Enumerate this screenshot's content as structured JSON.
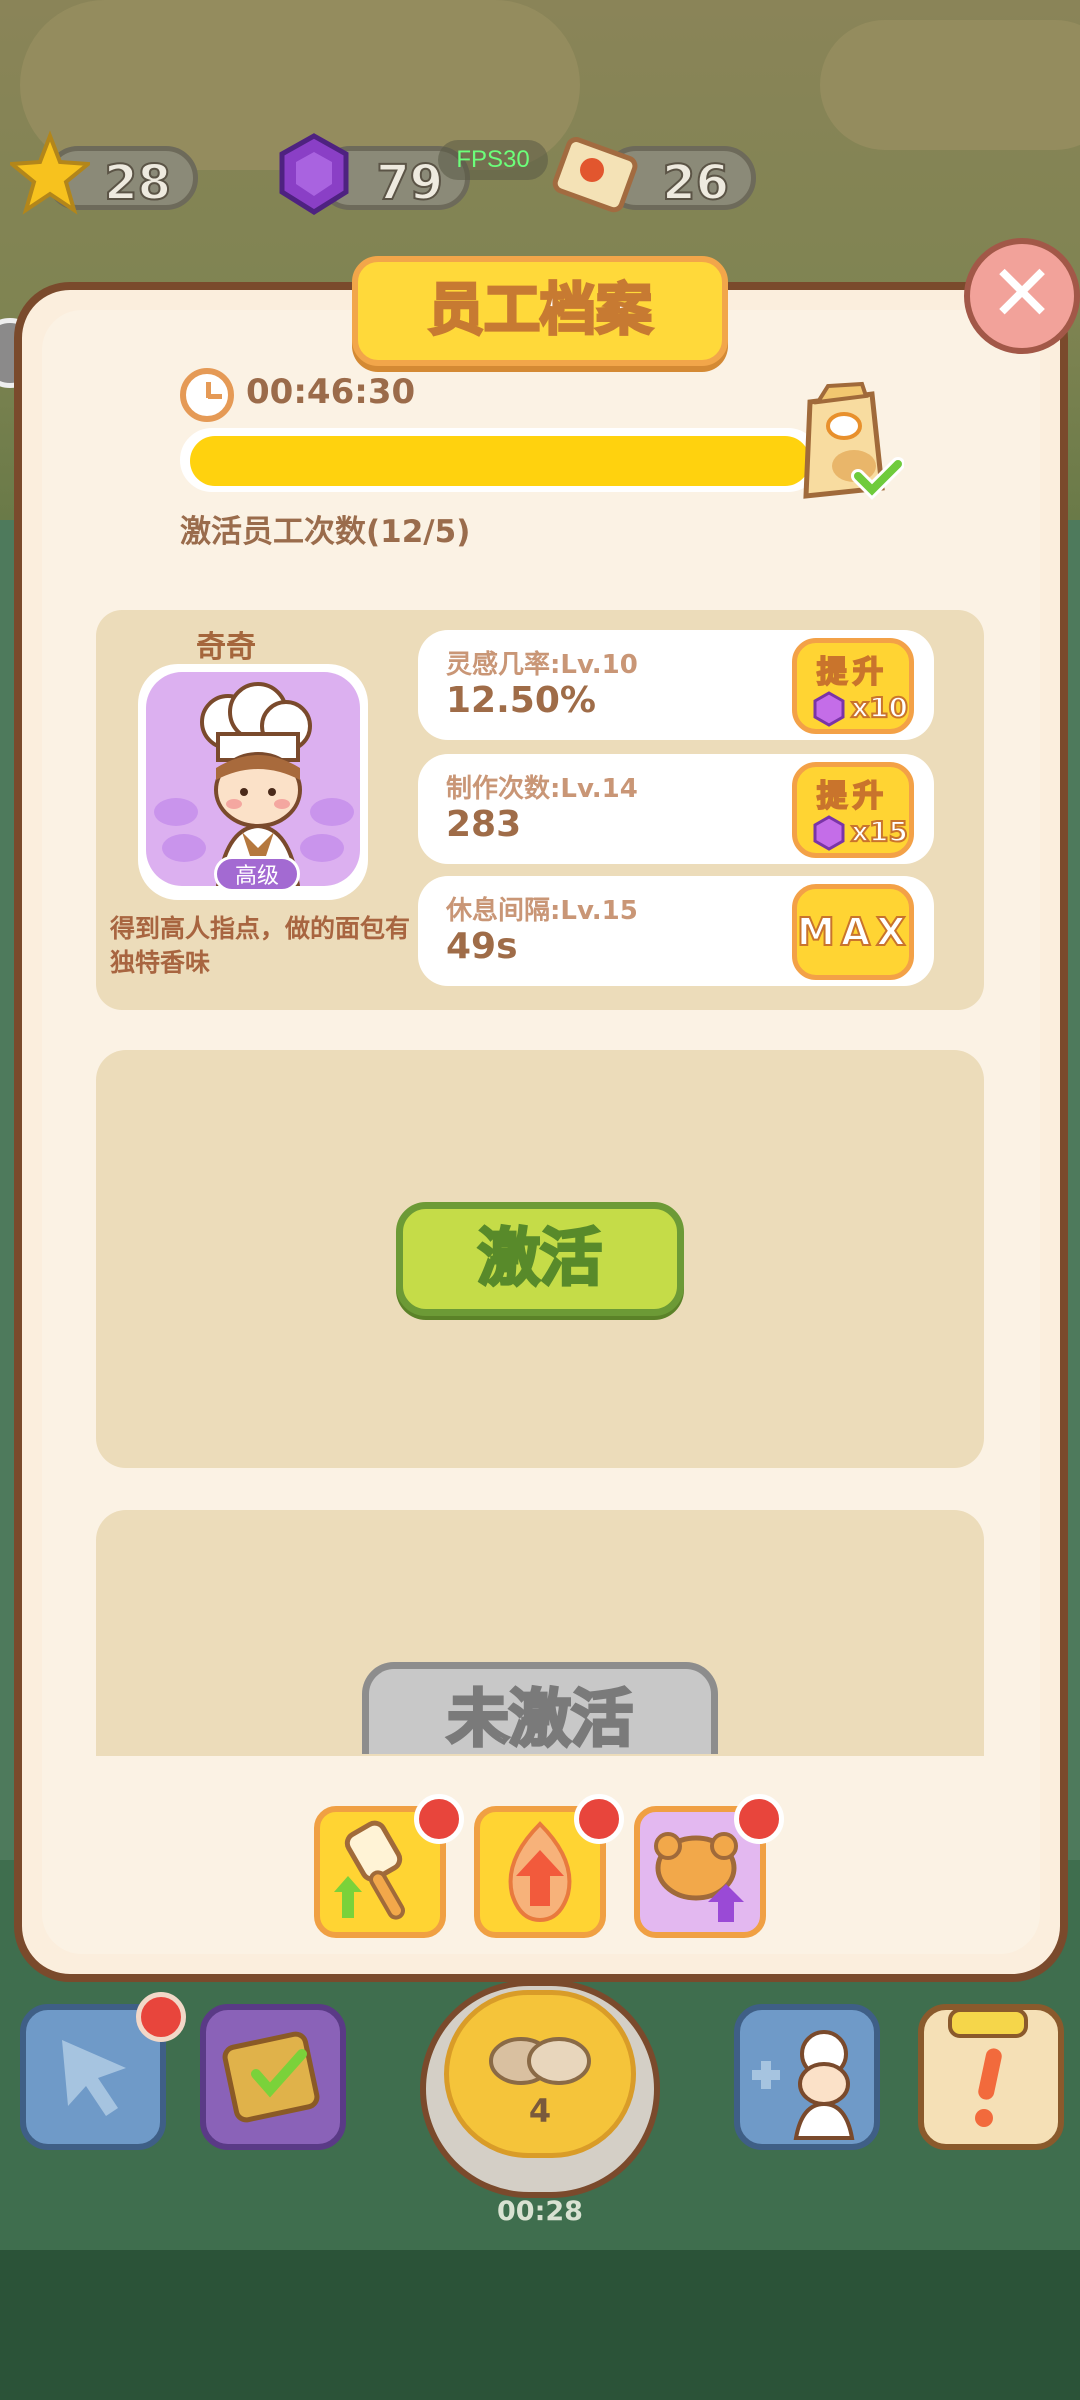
{
  "hud": {
    "stars": "28",
    "gems": "79",
    "tickets": "26",
    "fps": "FPS30"
  },
  "panel": {
    "title": "员工档案",
    "close_icon": "close-icon"
  },
  "timer": {
    "value": "00:46:30",
    "progress": 1.0,
    "activate_count": "激活员工次数(12/5)"
  },
  "employee": {
    "name": "奇奇",
    "grade": "高级",
    "description": "得到高人指点，做的面包有独特香味",
    "stats": [
      {
        "label": "灵感几率:Lv.10",
        "value": "12.50%",
        "button": "提升",
        "cost": "x10"
      },
      {
        "label": "制作次数:Lv.14",
        "value": "283",
        "button": "提升",
        "cost": "x15"
      },
      {
        "label": "休息间隔:Lv.15",
        "value": "49s",
        "button": "MAX"
      }
    ]
  },
  "slots": {
    "activate_label": "激活",
    "locked_label": "未激活"
  },
  "tabs": [
    "spatula-upgrade-icon",
    "fire-upgrade-icon",
    "bread-upgrade-icon"
  ],
  "bottom_nav": {
    "bake_count": "4",
    "bake_timer": "00:28"
  },
  "colors": {
    "accent_yellow": "#ffd433",
    "activate_green": "#c5dc48",
    "panel_border": "#7a4a2c",
    "notification_red": "#e8453c"
  }
}
